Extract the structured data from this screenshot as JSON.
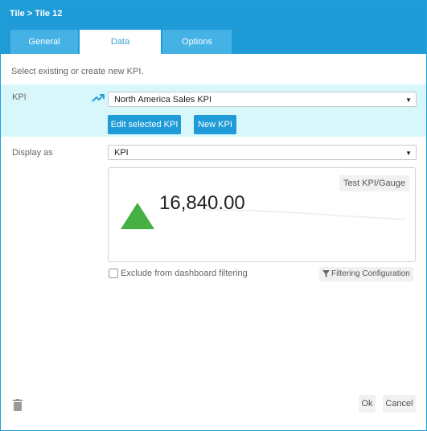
{
  "dialog": {
    "title": "Tile > Tile 12"
  },
  "tabs": [
    {
      "label": "General",
      "active": false
    },
    {
      "label": "Data",
      "active": true
    },
    {
      "label": "Options",
      "active": false
    }
  ],
  "intro_text": "Select existing or create new KPI.",
  "kpi_section": {
    "label": "KPI",
    "selected": "North America Sales KPI",
    "edit_button": "Edit selected KPI",
    "new_button": "New KPI"
  },
  "display_section": {
    "label": "Display as",
    "selected": "KPI"
  },
  "preview": {
    "test_button": "Test KPI/Gauge",
    "value": "16,840.00",
    "trend": "up",
    "trend_color": "#47b043"
  },
  "exclude_filter": {
    "label": "Exclude from dashboard filtering",
    "checked": false
  },
  "filter_config_button": "Filtering Configuration",
  "footer": {
    "ok": "Ok",
    "cancel": "Cancel"
  },
  "colors": {
    "accent": "#1f9bd7",
    "kpi_band": "#d7f7fb"
  }
}
